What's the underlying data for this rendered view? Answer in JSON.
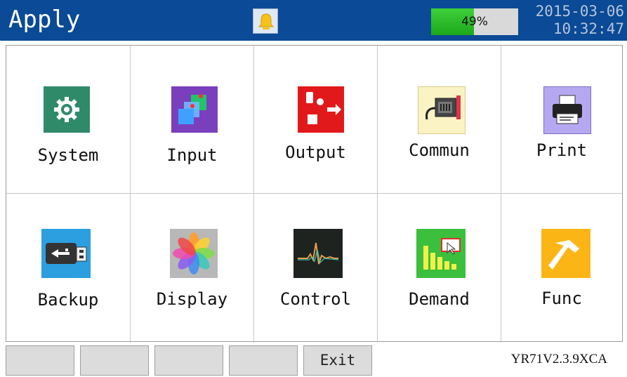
{
  "header": {
    "title": "Apply",
    "battery_percent": 49,
    "battery_label": "49%",
    "date": "2015-03-06",
    "time": "10:32:47",
    "accent": "#0a4a96"
  },
  "apps": [
    {
      "label": "System",
      "icon": "gear-icon"
    },
    {
      "label": "Input",
      "icon": "input-icon"
    },
    {
      "label": "Output",
      "icon": "output-icon"
    },
    {
      "label": "Commun",
      "icon": "serial-port-icon"
    },
    {
      "label": "Print",
      "icon": "printer-icon"
    },
    {
      "label": "Backup",
      "icon": "usb-icon"
    },
    {
      "label": "Display",
      "icon": "display-color-icon"
    },
    {
      "label": "Control",
      "icon": "waveform-icon"
    },
    {
      "label": "Demand",
      "icon": "bar-chart-icon"
    },
    {
      "label": "Func",
      "icon": "hammer-icon"
    }
  ],
  "footer": {
    "buttons": [
      "",
      "",
      "",
      "",
      "Exit"
    ],
    "version": "YR71V2.3.9XCA"
  }
}
